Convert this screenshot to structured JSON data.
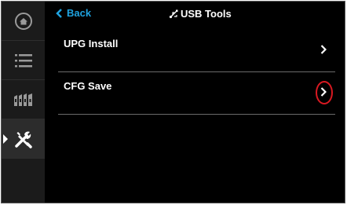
{
  "header": {
    "back_label": "Back",
    "title": "USB Tools"
  },
  "sidebar": {
    "items": [
      {
        "icon": "home-icon"
      },
      {
        "icon": "list-icon"
      },
      {
        "icon": "bookshelf-icon"
      },
      {
        "icon": "tools-icon",
        "active": true
      }
    ]
  },
  "list": {
    "items": [
      {
        "label": "UPG Install"
      },
      {
        "label": "CFG Save",
        "highlighted": true
      }
    ]
  },
  "colors": {
    "accent": "#1fa3e0",
    "highlight": "#d81921",
    "background": "#000000"
  }
}
